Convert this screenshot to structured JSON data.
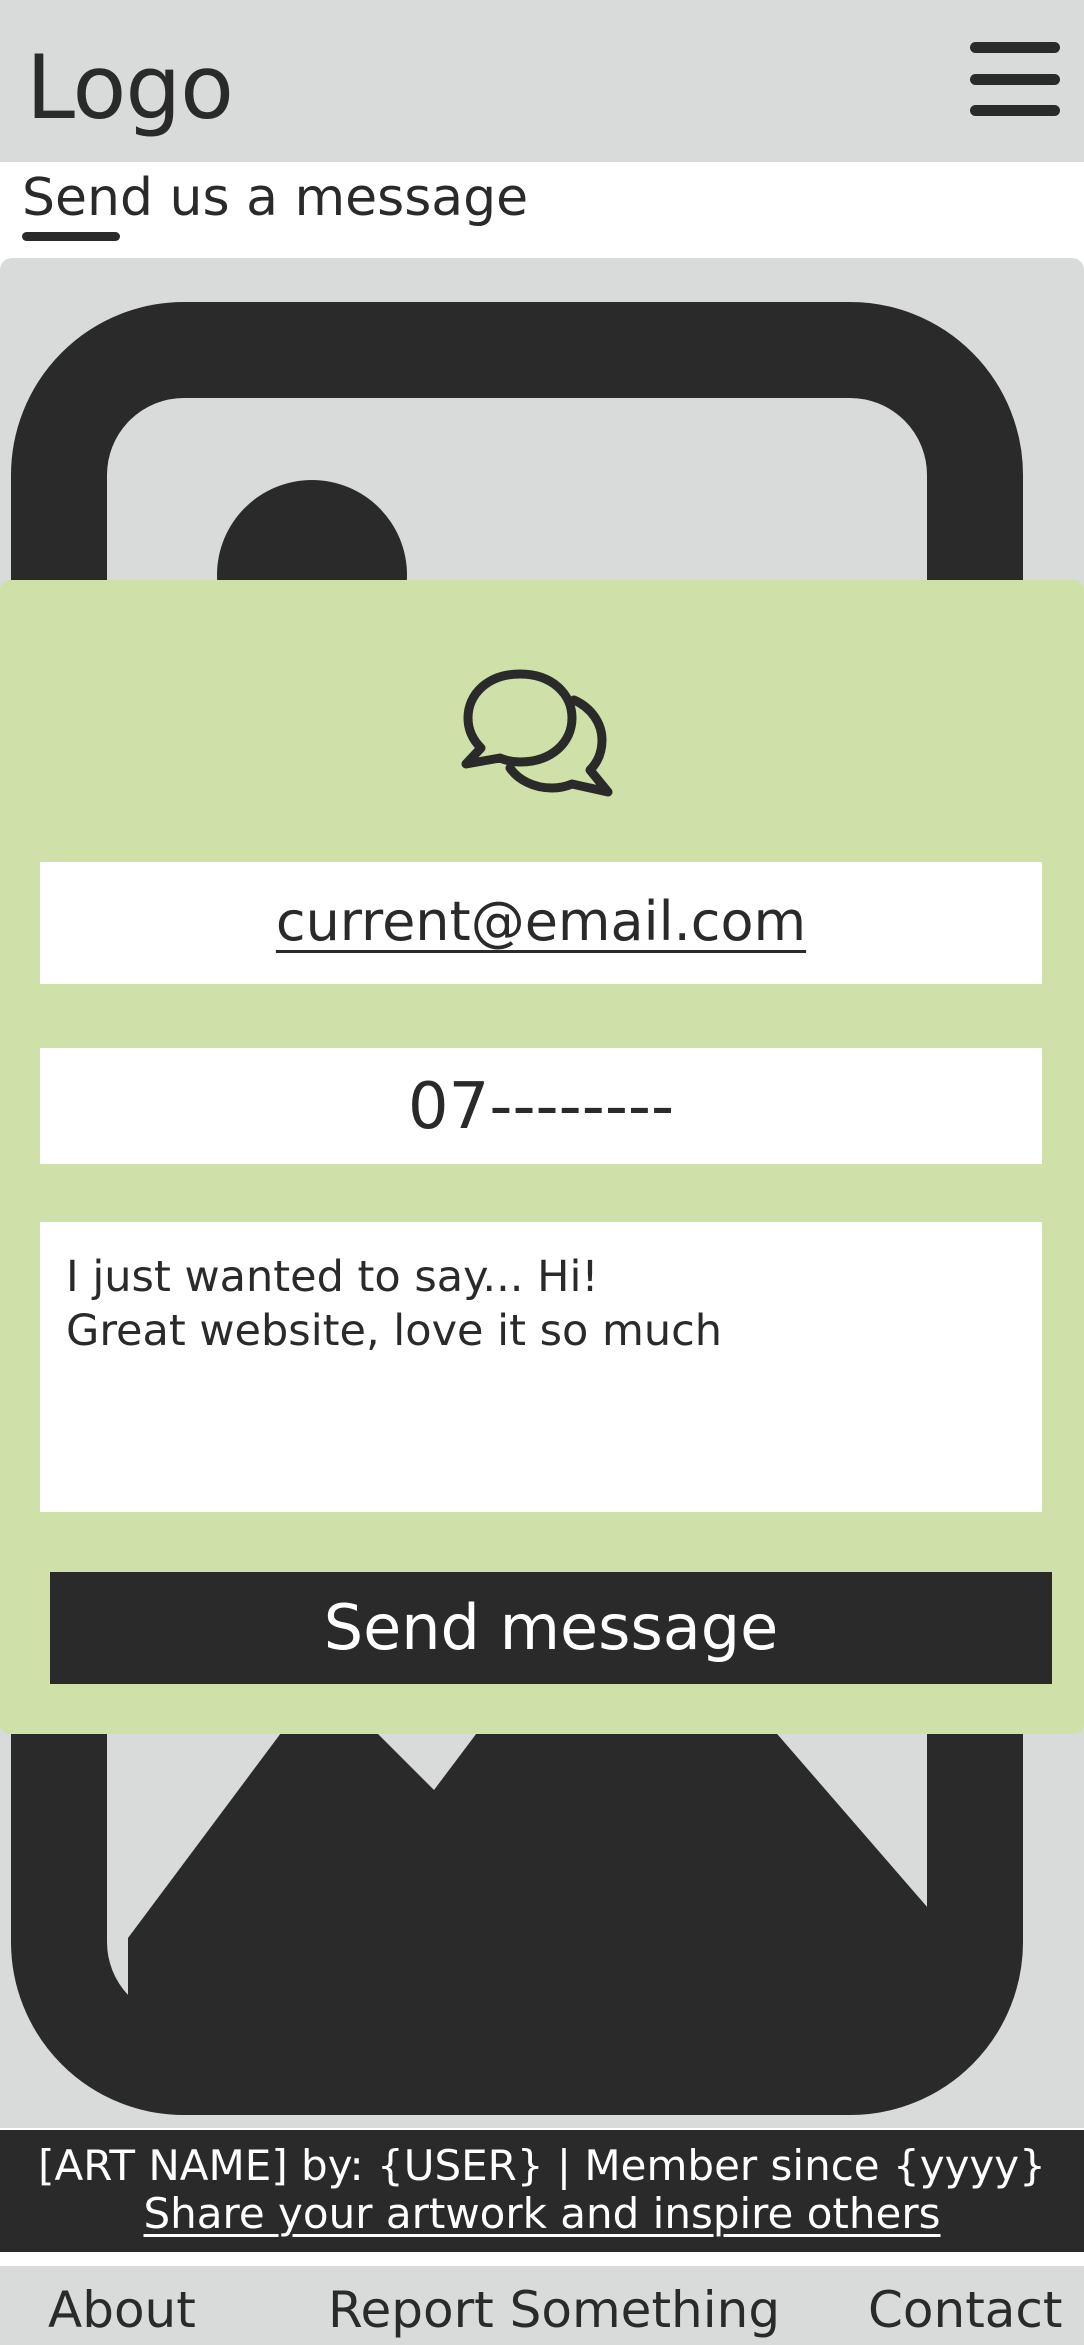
{
  "header": {
    "logo": "Logo",
    "menu_icon": "hamburger-menu-icon"
  },
  "page": {
    "title": "Send us a message"
  },
  "hero": {
    "image_icon": "image-placeholder-icon"
  },
  "form": {
    "icon": "chat-bubbles-icon",
    "email_value": "current@email.com",
    "phone_value": "07--------",
    "message_lines": [
      "I just wanted to say... Hi!",
      "Great website, love it so much"
    ],
    "send_label": "Send message",
    "panel_color": "#cfe0a8"
  },
  "info_bar": {
    "credit": "[ART NAME] by: {USER} | Member since {yyyy}",
    "share_link": "Share your artwork and inspire others"
  },
  "footer": {
    "links": [
      "About",
      "Report Something",
      "Contact"
    ]
  },
  "colors": {
    "background_gray": "#d9dbdb",
    "dark": "#2a2a2a",
    "accent_green": "#cfe0a8",
    "white": "#ffffff"
  }
}
